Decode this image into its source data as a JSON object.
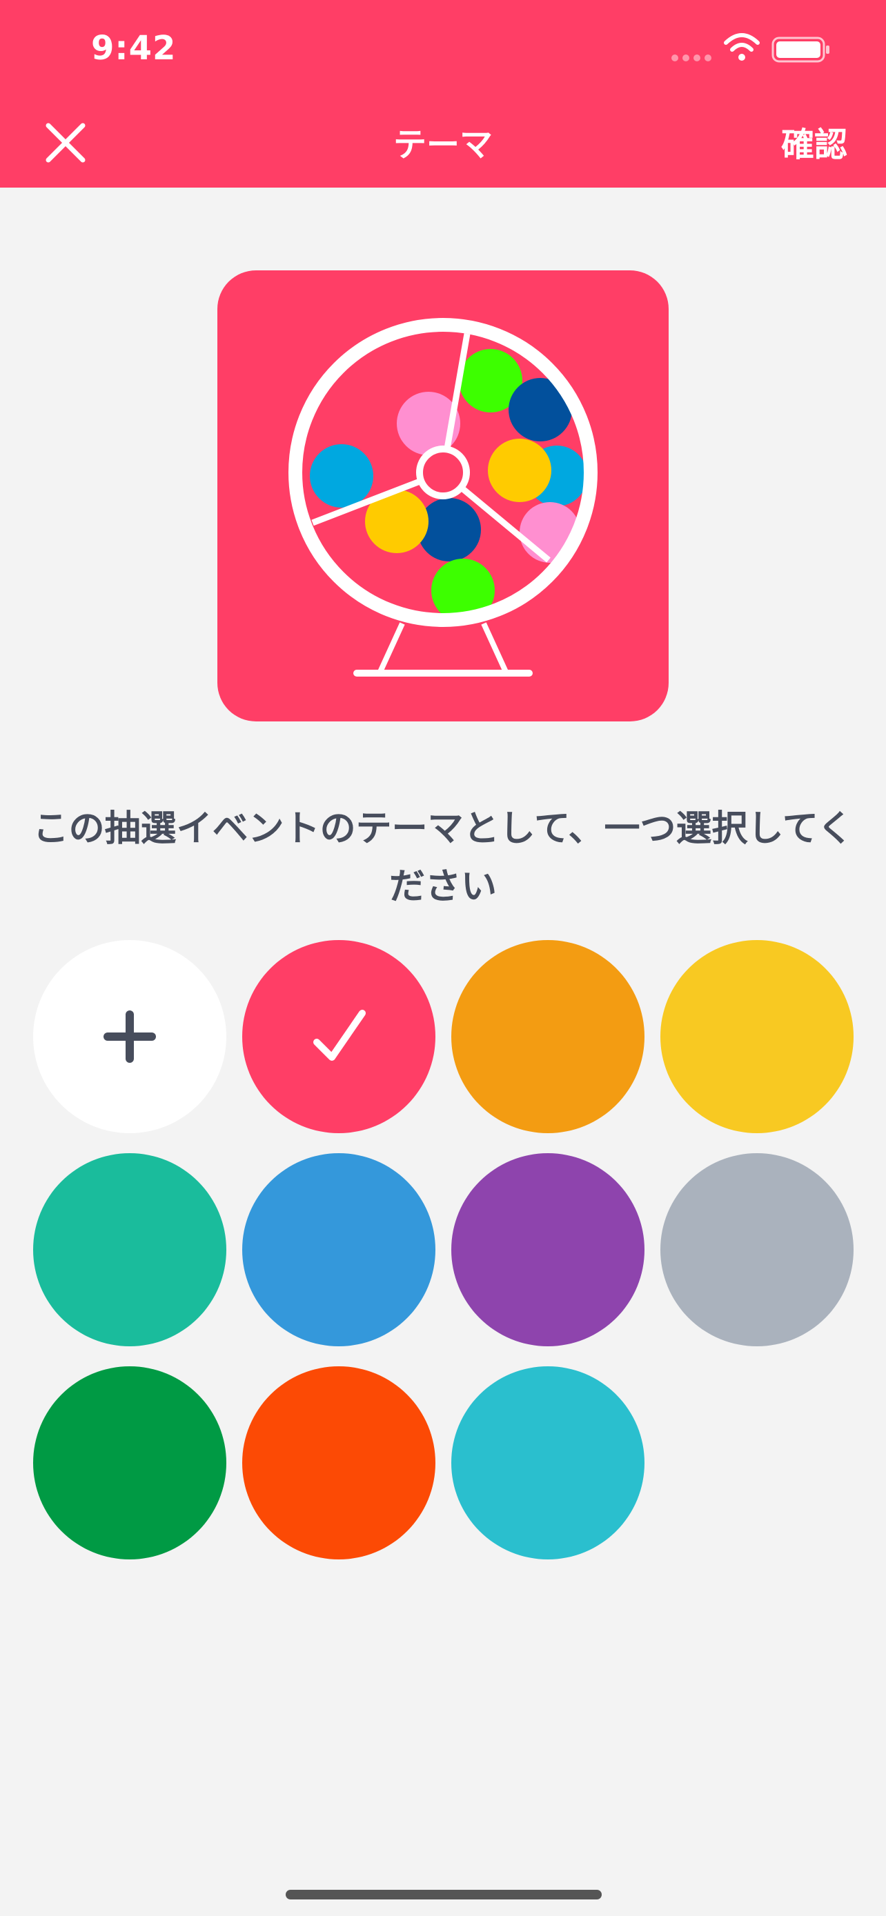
{
  "status_bar": {
    "time": "9:42"
  },
  "header": {
    "title": "テーマ",
    "confirm_label": "確認"
  },
  "instruction": "この抽選イベントのテーマとして、一つ選択してください",
  "colors": {
    "accent": "#ff3e66",
    "swatches": [
      "#ffffff",
      "#ff3e66",
      "#f39c12",
      "#f8c922",
      "#1abc9c",
      "#3498db",
      "#8e44ad",
      "#aab2bd",
      "#009a44",
      "#fc4a05",
      "#2abfce"
    ],
    "selected_index": 1
  },
  "icons": {
    "close": "close-icon",
    "add": "plus-icon",
    "selected": "checkmark-icon"
  }
}
